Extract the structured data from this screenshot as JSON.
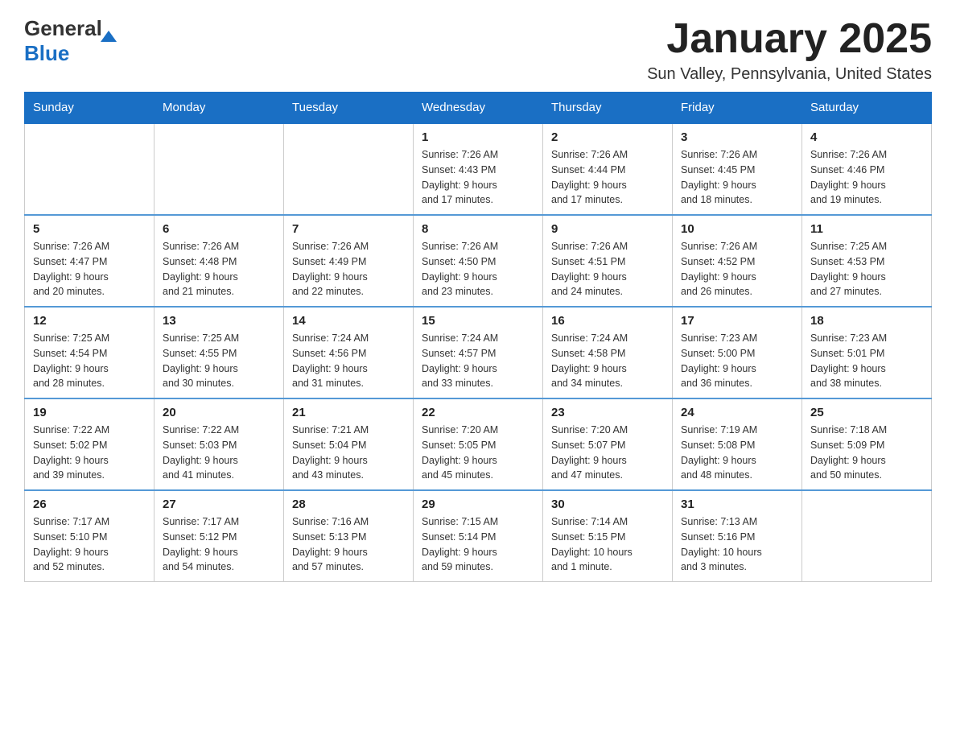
{
  "header": {
    "logo_general": "General",
    "logo_blue": "Blue",
    "main_title": "January 2025",
    "subtitle": "Sun Valley, Pennsylvania, United States"
  },
  "days_of_week": [
    "Sunday",
    "Monday",
    "Tuesday",
    "Wednesday",
    "Thursday",
    "Friday",
    "Saturday"
  ],
  "weeks": [
    {
      "days": [
        {
          "number": "",
          "info": ""
        },
        {
          "number": "",
          "info": ""
        },
        {
          "number": "",
          "info": ""
        },
        {
          "number": "1",
          "info": "Sunrise: 7:26 AM\nSunset: 4:43 PM\nDaylight: 9 hours\nand 17 minutes."
        },
        {
          "number": "2",
          "info": "Sunrise: 7:26 AM\nSunset: 4:44 PM\nDaylight: 9 hours\nand 17 minutes."
        },
        {
          "number": "3",
          "info": "Sunrise: 7:26 AM\nSunset: 4:45 PM\nDaylight: 9 hours\nand 18 minutes."
        },
        {
          "number": "4",
          "info": "Sunrise: 7:26 AM\nSunset: 4:46 PM\nDaylight: 9 hours\nand 19 minutes."
        }
      ]
    },
    {
      "days": [
        {
          "number": "5",
          "info": "Sunrise: 7:26 AM\nSunset: 4:47 PM\nDaylight: 9 hours\nand 20 minutes."
        },
        {
          "number": "6",
          "info": "Sunrise: 7:26 AM\nSunset: 4:48 PM\nDaylight: 9 hours\nand 21 minutes."
        },
        {
          "number": "7",
          "info": "Sunrise: 7:26 AM\nSunset: 4:49 PM\nDaylight: 9 hours\nand 22 minutes."
        },
        {
          "number": "8",
          "info": "Sunrise: 7:26 AM\nSunset: 4:50 PM\nDaylight: 9 hours\nand 23 minutes."
        },
        {
          "number": "9",
          "info": "Sunrise: 7:26 AM\nSunset: 4:51 PM\nDaylight: 9 hours\nand 24 minutes."
        },
        {
          "number": "10",
          "info": "Sunrise: 7:26 AM\nSunset: 4:52 PM\nDaylight: 9 hours\nand 26 minutes."
        },
        {
          "number": "11",
          "info": "Sunrise: 7:25 AM\nSunset: 4:53 PM\nDaylight: 9 hours\nand 27 minutes."
        }
      ]
    },
    {
      "days": [
        {
          "number": "12",
          "info": "Sunrise: 7:25 AM\nSunset: 4:54 PM\nDaylight: 9 hours\nand 28 minutes."
        },
        {
          "number": "13",
          "info": "Sunrise: 7:25 AM\nSunset: 4:55 PM\nDaylight: 9 hours\nand 30 minutes."
        },
        {
          "number": "14",
          "info": "Sunrise: 7:24 AM\nSunset: 4:56 PM\nDaylight: 9 hours\nand 31 minutes."
        },
        {
          "number": "15",
          "info": "Sunrise: 7:24 AM\nSunset: 4:57 PM\nDaylight: 9 hours\nand 33 minutes."
        },
        {
          "number": "16",
          "info": "Sunrise: 7:24 AM\nSunset: 4:58 PM\nDaylight: 9 hours\nand 34 minutes."
        },
        {
          "number": "17",
          "info": "Sunrise: 7:23 AM\nSunset: 5:00 PM\nDaylight: 9 hours\nand 36 minutes."
        },
        {
          "number": "18",
          "info": "Sunrise: 7:23 AM\nSunset: 5:01 PM\nDaylight: 9 hours\nand 38 minutes."
        }
      ]
    },
    {
      "days": [
        {
          "number": "19",
          "info": "Sunrise: 7:22 AM\nSunset: 5:02 PM\nDaylight: 9 hours\nand 39 minutes."
        },
        {
          "number": "20",
          "info": "Sunrise: 7:22 AM\nSunset: 5:03 PM\nDaylight: 9 hours\nand 41 minutes."
        },
        {
          "number": "21",
          "info": "Sunrise: 7:21 AM\nSunset: 5:04 PM\nDaylight: 9 hours\nand 43 minutes."
        },
        {
          "number": "22",
          "info": "Sunrise: 7:20 AM\nSunset: 5:05 PM\nDaylight: 9 hours\nand 45 minutes."
        },
        {
          "number": "23",
          "info": "Sunrise: 7:20 AM\nSunset: 5:07 PM\nDaylight: 9 hours\nand 47 minutes."
        },
        {
          "number": "24",
          "info": "Sunrise: 7:19 AM\nSunset: 5:08 PM\nDaylight: 9 hours\nand 48 minutes."
        },
        {
          "number": "25",
          "info": "Sunrise: 7:18 AM\nSunset: 5:09 PM\nDaylight: 9 hours\nand 50 minutes."
        }
      ]
    },
    {
      "days": [
        {
          "number": "26",
          "info": "Sunrise: 7:17 AM\nSunset: 5:10 PM\nDaylight: 9 hours\nand 52 minutes."
        },
        {
          "number": "27",
          "info": "Sunrise: 7:17 AM\nSunset: 5:12 PM\nDaylight: 9 hours\nand 54 minutes."
        },
        {
          "number": "28",
          "info": "Sunrise: 7:16 AM\nSunset: 5:13 PM\nDaylight: 9 hours\nand 57 minutes."
        },
        {
          "number": "29",
          "info": "Sunrise: 7:15 AM\nSunset: 5:14 PM\nDaylight: 9 hours\nand 59 minutes."
        },
        {
          "number": "30",
          "info": "Sunrise: 7:14 AM\nSunset: 5:15 PM\nDaylight: 10 hours\nand 1 minute."
        },
        {
          "number": "31",
          "info": "Sunrise: 7:13 AM\nSunset: 5:16 PM\nDaylight: 10 hours\nand 3 minutes."
        },
        {
          "number": "",
          "info": ""
        }
      ]
    }
  ]
}
